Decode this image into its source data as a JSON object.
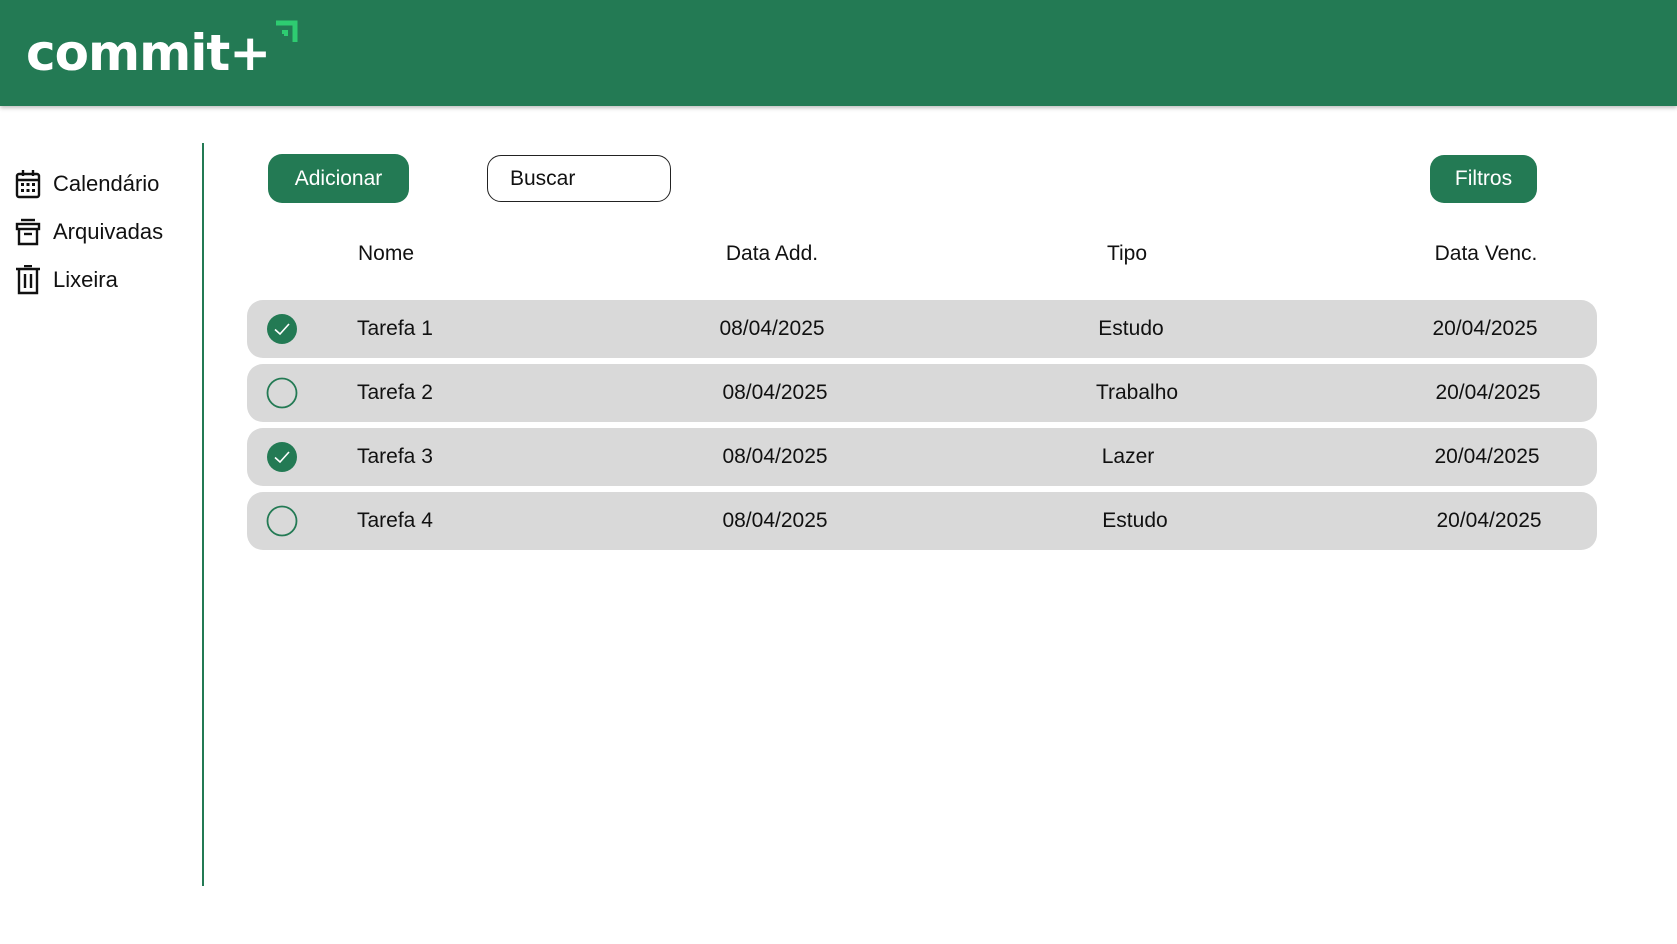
{
  "header": {
    "logo_text": "commit+",
    "brand_color": "#237a54",
    "accent_color": "#2ecc71"
  },
  "sidebar": {
    "items": [
      {
        "label": "Calendário",
        "icon": "calendar-icon"
      },
      {
        "label": "Arquivadas",
        "icon": "archive-icon"
      },
      {
        "label": "Lixeira",
        "icon": "trash-icon"
      }
    ]
  },
  "toolbar": {
    "add_label": "Adicionar",
    "search_placeholder": "Buscar",
    "filter_label": "Filtros"
  },
  "table": {
    "headers": [
      "Nome",
      "Data Add.",
      "Tipo",
      "Data Venc."
    ],
    "rows": [
      {
        "done": true,
        "name": "Tarefa 1",
        "added": "08/04/2025",
        "type": "Estudo",
        "due": "20/04/2025"
      },
      {
        "done": false,
        "name": "Tarefa 2",
        "added": "08/04/2025",
        "type": "Trabalho",
        "due": "20/04/2025"
      },
      {
        "done": true,
        "name": "Tarefa 3",
        "added": "08/04/2025",
        "type": "Lazer",
        "due": "20/04/2025"
      },
      {
        "done": false,
        "name": "Tarefa 4",
        "added": "08/04/2025",
        "type": "Estudo",
        "due": "20/04/2025"
      }
    ]
  }
}
